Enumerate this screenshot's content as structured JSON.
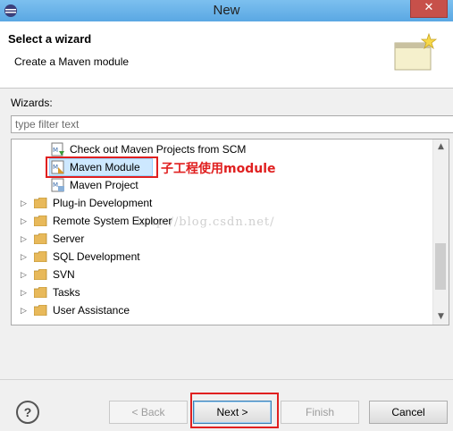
{
  "window": {
    "title": "New",
    "close_label": "✕"
  },
  "header": {
    "title": "Select a wizard",
    "description": "Create a Maven module"
  },
  "filter": {
    "label": "Wizards:",
    "placeholder": "type filter text"
  },
  "tree": {
    "items": [
      {
        "label": "Check out Maven Projects from SCM",
        "type": "maven-checkout"
      },
      {
        "label": "Maven Module",
        "type": "maven-module",
        "selected": true
      },
      {
        "label": "Maven Project",
        "type": "maven-project"
      },
      {
        "label": "Plug-in Development",
        "type": "folder"
      },
      {
        "label": "Remote System Explorer",
        "type": "folder"
      },
      {
        "label": "Server",
        "type": "folder"
      },
      {
        "label": "SQL Development",
        "type": "folder"
      },
      {
        "label": "SVN",
        "type": "folder"
      },
      {
        "label": "Tasks",
        "type": "folder"
      },
      {
        "label": "User Assistance",
        "type": "folder"
      }
    ]
  },
  "annotation": {
    "text": "子工程使用module",
    "color": "#e02020"
  },
  "watermark": "http://blog.csdn.net/",
  "buttons": {
    "help": "?",
    "back": "< Back",
    "next": "Next >",
    "finish": "Finish",
    "cancel": "Cancel"
  },
  "colors": {
    "highlight": "#e02020",
    "selection": "#cde8ff"
  }
}
